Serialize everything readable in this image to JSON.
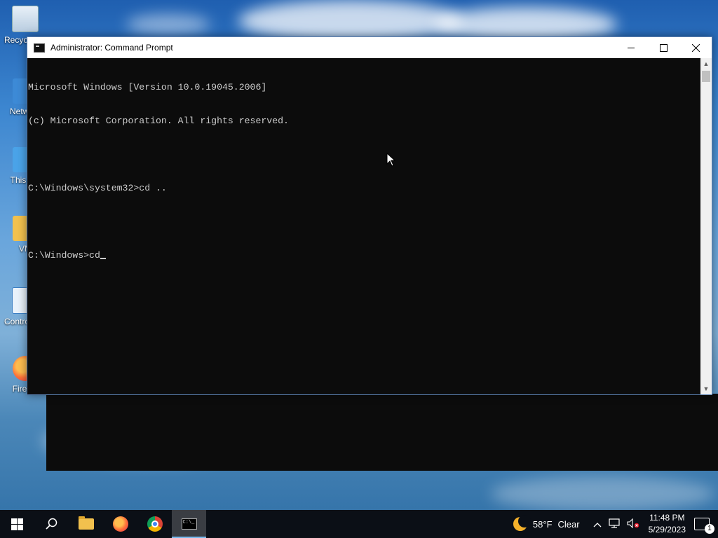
{
  "desktop": {
    "icons": [
      {
        "label": "Recycle Bin",
        "icon": "recycle-bin-icon"
      },
      {
        "label": "Network",
        "icon": "network-icon"
      },
      {
        "label": "This PC",
        "icon": "this-pc-icon"
      },
      {
        "label": "VM",
        "icon": "folder-icon"
      },
      {
        "label": "Control Panel",
        "icon": "control-panel-icon"
      },
      {
        "label": "Firefox",
        "icon": "firefox-icon"
      }
    ]
  },
  "window": {
    "title": "Administrator: Command Prompt",
    "console_lines": [
      "Microsoft Windows [Version 10.0.19045.2006]",
      "(c) Microsoft Corporation. All rights reserved.",
      "",
      "C:\\Windows\\system32>cd ..",
      "",
      "C:\\Windows>cd"
    ]
  },
  "taskbar": {
    "apps": [
      "start-button",
      "search-button",
      "file-explorer",
      "firefox",
      "chrome",
      "command-prompt"
    ],
    "active_app": "command-prompt",
    "weather": {
      "temp": "58°F",
      "condition": "Clear"
    },
    "clock": {
      "time": "11:48 PM",
      "date": "5/29/2023"
    },
    "notification_count": "1"
  },
  "colors": {
    "console_bg": "#0c0c0c",
    "console_fg": "#cccccc",
    "taskbar_bg": "#0b0f16",
    "accent": "#76b9ed"
  }
}
